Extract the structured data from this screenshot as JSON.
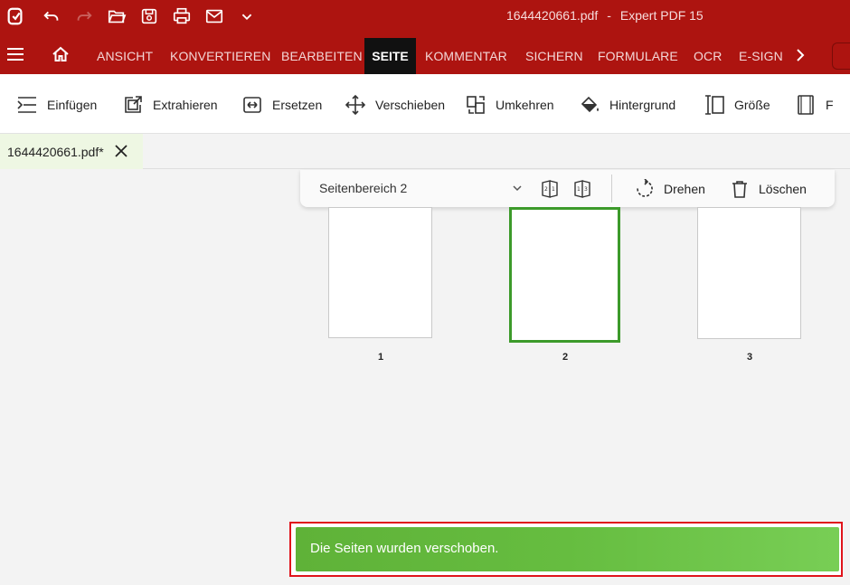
{
  "window": {
    "file_name": "1644420661.pdf",
    "separator": "-",
    "app_name": "Expert PDF 15"
  },
  "quick_access": [
    "app-logo-icon",
    "undo-icon",
    "redo-icon",
    "open-folder-icon",
    "save-icon",
    "print-icon",
    "mail-icon",
    "customize-chevron-icon"
  ],
  "ribbon": {
    "tabs": [
      "ANSICHT",
      "KONVERTIEREN",
      "BEARBEITEN",
      "SEITE",
      "KOMMENTAR",
      "SICHERN",
      "FORMULARE",
      "OCR",
      "E-SIGN"
    ],
    "active_tab": "SEITE"
  },
  "toolbar": {
    "insert": "Einfügen",
    "extract": "Extrahieren",
    "replace": "Ersetzen",
    "move": "Verschieben",
    "reverse": "Umkehren",
    "background": "Hintergrund",
    "size": "Größe",
    "cut_off": "F"
  },
  "document_tab": {
    "label": "1644420661.pdf*"
  },
  "page_bar": {
    "range_label": "Seitenbereich 2",
    "rotate": "Drehen",
    "delete": "Löschen"
  },
  "pages": [
    {
      "number": "1",
      "selected": false
    },
    {
      "number": "2",
      "selected": true
    },
    {
      "number": "3",
      "selected": false
    }
  ],
  "toast": {
    "message": "Die Seiten wurden verschoben."
  },
  "colors": {
    "brand_red": "#ad1410",
    "active_tab": "#111111",
    "selection_green": "#3c9a2a",
    "toast_green": "#66bd40",
    "highlight_red": "#e0141b"
  }
}
